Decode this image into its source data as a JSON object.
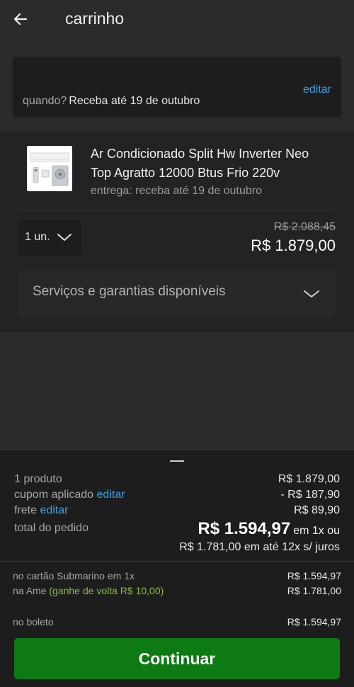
{
  "header": {
    "title": "carrinho",
    "back_icon": "arrow-left-icon"
  },
  "delivery": {
    "edit_label": "editar",
    "when_label": "quando?",
    "date_text": "Receba até 19 de outubro"
  },
  "product": {
    "name": "Ar Condicionado Split Hw Inverter Neo Top Agratto 12000 Btus Frio 220v",
    "delivery_text": "entrega: receba até 19 de outubro",
    "quantity": "1 un.",
    "old_price": "R$ 2.088,45",
    "price": "R$ 1.879,00",
    "services_label": "Serviços e garantias disponíveis"
  },
  "summary": {
    "products_label": "1 produto",
    "products_value": "R$ 1.879,00",
    "coupon_label": "cupom aplicado",
    "coupon_edit": "editar",
    "coupon_value": "- R$ 187,90",
    "shipping_label": "frete",
    "shipping_edit": "editar",
    "shipping_value": "R$ 89,90",
    "total_label": "total do pedido",
    "total_value": "R$ 1.594,97",
    "total_suffix": "em 1x ou",
    "installments": "R$ 1.781,00 em até 12x s/ juros"
  },
  "payments": [
    {
      "label": "no cartão Submarino em 1x",
      "extra": "",
      "value": "R$ 1.594,97"
    },
    {
      "label": "na Ame",
      "extra": "(ganhe de volta R$ 10,00)",
      "value": "R$ 1.781,00"
    },
    {
      "label": "no boleto",
      "extra": "",
      "value": "R$ 1.594,97"
    }
  ],
  "continue_label": "Continuar",
  "colors": {
    "accent": "#3ba1de",
    "success": "#8bbd45",
    "button": "#0d7a14"
  }
}
